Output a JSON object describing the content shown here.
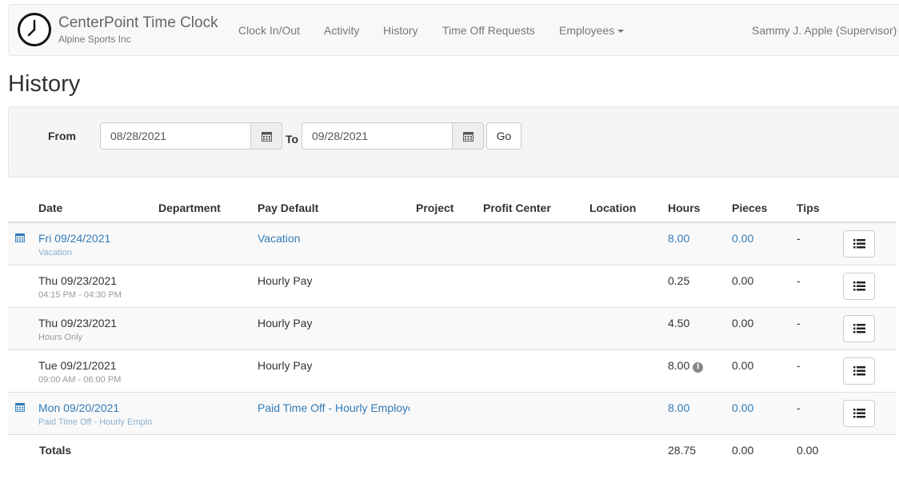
{
  "app": {
    "title": "CenterPoint Time Clock",
    "company": "Alpine Sports Inc"
  },
  "nav": {
    "items": [
      "Clock In/Out",
      "Activity",
      "History",
      "Time Off Requests",
      "Employees"
    ],
    "user": "Sammy J. Apple (Supervisor)"
  },
  "page": {
    "title": "History"
  },
  "filter": {
    "from_label": "From",
    "from_value": "08/28/2021",
    "to_label": "To",
    "to_value": "09/28/2021",
    "go_label": "Go"
  },
  "table": {
    "headers": [
      "Date",
      "Department",
      "Pay Default",
      "Project",
      "Profit Center",
      "Location",
      "Hours",
      "Pieces",
      "Tips"
    ],
    "rows": [
      {
        "date": "Fri 09/24/2021",
        "sub": "Vacation",
        "pay": "Vacation",
        "hours": "8.00",
        "pieces": "0.00",
        "tips": "-"
      },
      {
        "date": "Thu 09/23/2021",
        "sub": "04:15 PM - 04:30 PM",
        "pay": "Hourly Pay",
        "hours": "0.25",
        "pieces": "0.00",
        "tips": "-"
      },
      {
        "date": "Thu 09/23/2021",
        "sub": "Hours Only",
        "pay": "Hourly Pay",
        "hours": "4.50",
        "pieces": "0.00",
        "tips": "-"
      },
      {
        "date": "Tue 09/21/2021",
        "sub": "09:00 AM - 06:00 PM",
        "pay": "Hourly Pay",
        "hours": "8.00",
        "pieces": "0.00",
        "tips": "-"
      },
      {
        "date": "Mon 09/20/2021",
        "sub": "Paid Time Off - Hourly Employees",
        "pay": "Paid Time Off - Hourly Employees",
        "hours": "8.00",
        "pieces": "0.00",
        "tips": "-"
      }
    ],
    "totals": {
      "label": "Totals",
      "hours": "28.75",
      "pieces": "0.00",
      "tips": "0.00"
    }
  },
  "icons": {
    "logo": "clock-icon",
    "calendar": "calendar-icon",
    "details": "list-icon",
    "info": "info-icon"
  },
  "colors": {
    "link": "#337ab7",
    "navbar_bg": "#f8f8f8",
    "well_bg": "#f5f5f5",
    "stripe": "#f9f9f9"
  }
}
